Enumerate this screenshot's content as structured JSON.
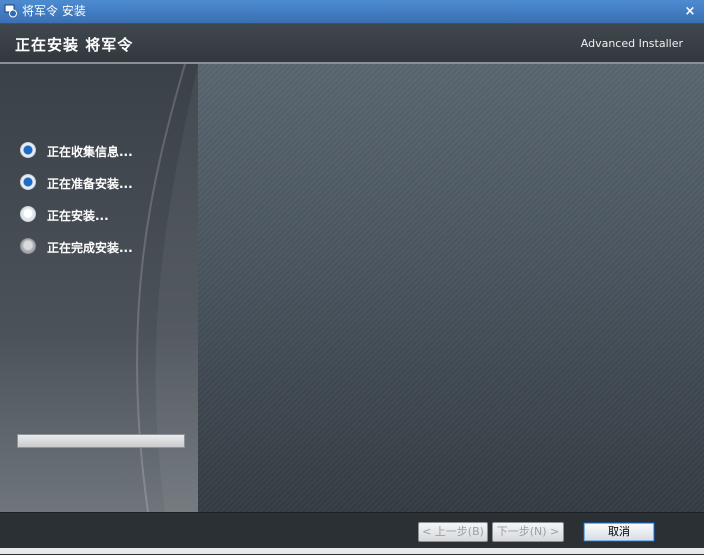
{
  "window": {
    "title": "将军令 安装",
    "close_label": "×"
  },
  "header": {
    "title": "正在安装 将军令",
    "brand": "Advanced Installer"
  },
  "steps": [
    {
      "label": "正在收集信息...",
      "state": "done"
    },
    {
      "label": "正在准备安装...",
      "state": "done"
    },
    {
      "label": "正在安装...",
      "state": "active"
    },
    {
      "label": "正在完成安装...",
      "state": "pending"
    }
  ],
  "progress": {
    "fraction": 0.0
  },
  "buttons": {
    "back": "< 上一步(B)",
    "next": "下一步(N) >",
    "cancel": "取消"
  },
  "colors": {
    "accent": "#1d6cc6",
    "titlebar": "#4d8bd0"
  }
}
